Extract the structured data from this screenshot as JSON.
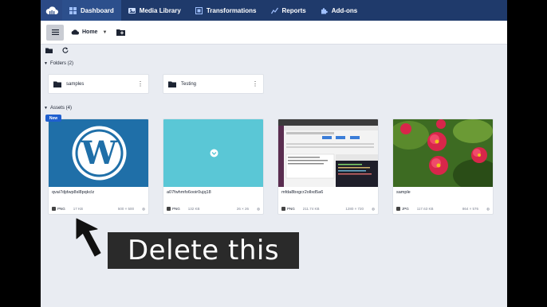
{
  "nav": {
    "items": [
      {
        "label": "Dashboard",
        "icon": "dashboard-icon",
        "active": true
      },
      {
        "label": "Media Library",
        "icon": "media-library-icon",
        "active": false
      },
      {
        "label": "Transformations",
        "icon": "transformations-icon",
        "active": false
      },
      {
        "label": "Reports",
        "icon": "reports-icon",
        "active": false
      },
      {
        "label": "Add-ons",
        "icon": "addons-icon",
        "active": false
      }
    ]
  },
  "toolbar": {
    "breadcrumb_label": "Home"
  },
  "folders": {
    "title": "Folders (2)",
    "items": [
      {
        "name": "samples"
      },
      {
        "name": "Testing"
      }
    ]
  },
  "assets": {
    "title": "Assets (4)",
    "new_badge": "New",
    "items": [
      {
        "name": "qvai7djdwp8sl8pqkclz",
        "format": "PNG",
        "size": "17 KB",
        "dims": "500 × 500"
      },
      {
        "name": "a07fwhmfo6ooir0ujq18",
        "format": "PNG",
        "size": "132 KB",
        "dims": "26 × 26"
      },
      {
        "name": "mfda8bxgcr2ollxd5a6",
        "format": "PNG",
        "size": "211.74 KB",
        "dims": "1280 × 720"
      },
      {
        "name": "sample",
        "format": "JPG",
        "size": "117.63 KB",
        "dims": "864 × 576"
      }
    ]
  },
  "overlay": {
    "caption": "Delete this"
  },
  "colors": {
    "topnav_bg": "#1f3a6b",
    "active_tab": "#2c4f8c",
    "accent": "#1f5fcf",
    "wordpress_bg": "#1f6fa8",
    "teal_thumb": "#5ac7d6"
  }
}
